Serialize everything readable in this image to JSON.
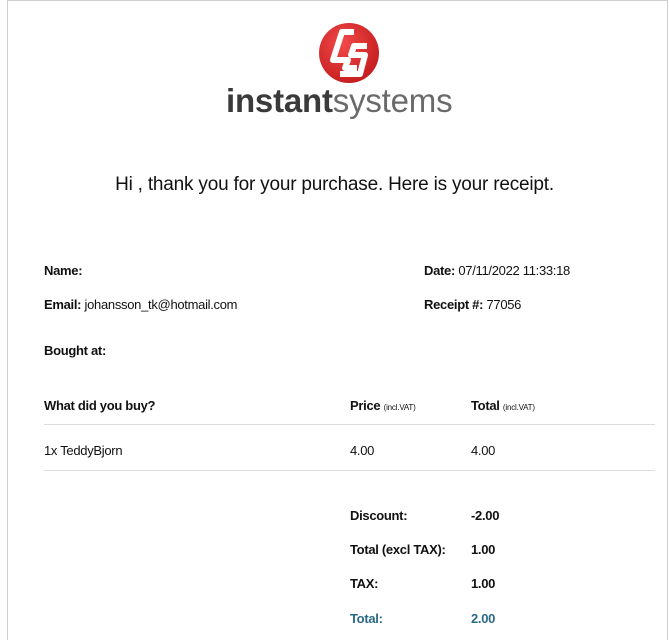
{
  "brand": {
    "name_bold": "instant",
    "name_light": "systems",
    "accent": "#d42626"
  },
  "headline": "Hi , thank you for your purchase. Here is your receipt.",
  "customer": {
    "name_label": "Name:",
    "name_value": "",
    "email_label": "Email:",
    "email_value": "johansson_tk@hotmail.com",
    "bought_at_label": "Bought at:",
    "bought_at_value": ""
  },
  "meta": {
    "date_label": "Date:",
    "date_value": "07/11/2022 11:33:18",
    "receipt_label": "Receipt #:",
    "receipt_value": "77056"
  },
  "table": {
    "col_item": "What did you buy?",
    "col_price": "Price",
    "col_price_note": "(incl.VAT)",
    "col_total": "Total",
    "col_total_note": "(incl.VAT)",
    "rows": [
      {
        "item": "1x TeddyBjorn",
        "price": "4.00",
        "total": "4.00"
      }
    ]
  },
  "summary": {
    "discount_label": "Discount:",
    "discount_value": "-2.00",
    "excl_label": "Total (excl TAX):",
    "excl_value": "1.00",
    "tax_label": "TAX:",
    "tax_value": "1.00",
    "total_label": "Total:",
    "total_value": "2.00",
    "total_color": "#2a6a86"
  }
}
